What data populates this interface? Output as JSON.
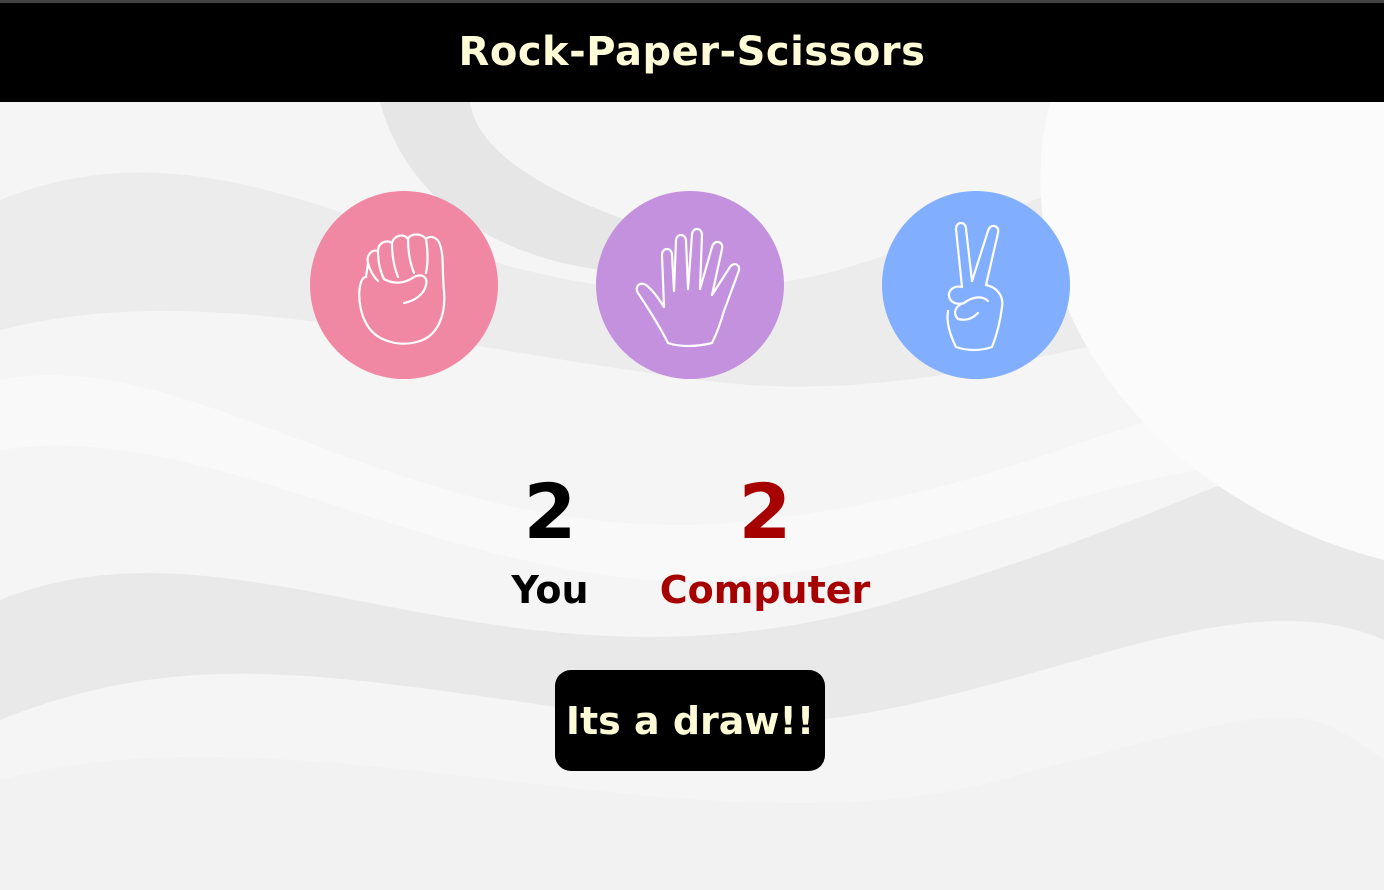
{
  "header": {
    "title": "Rock-Paper-Scissors"
  },
  "choices": [
    {
      "name": "rock",
      "icon": "fist-icon",
      "color": "#f088a4"
    },
    {
      "name": "paper",
      "icon": "open-hand-icon",
      "color": "#c391dd"
    },
    {
      "name": "scissors",
      "icon": "peace-hand-icon",
      "color": "#82aeff"
    }
  ],
  "scoreboard": {
    "user": {
      "score": "2",
      "label": "You",
      "color": "#000000"
    },
    "computer": {
      "score": "2",
      "label": "Computer",
      "color": "#a60000"
    }
  },
  "result": {
    "message": "Its a draw!!"
  },
  "colors": {
    "header_bg": "#000000",
    "header_text": "#fffbd6",
    "page_bg": "#f4f4f4"
  }
}
